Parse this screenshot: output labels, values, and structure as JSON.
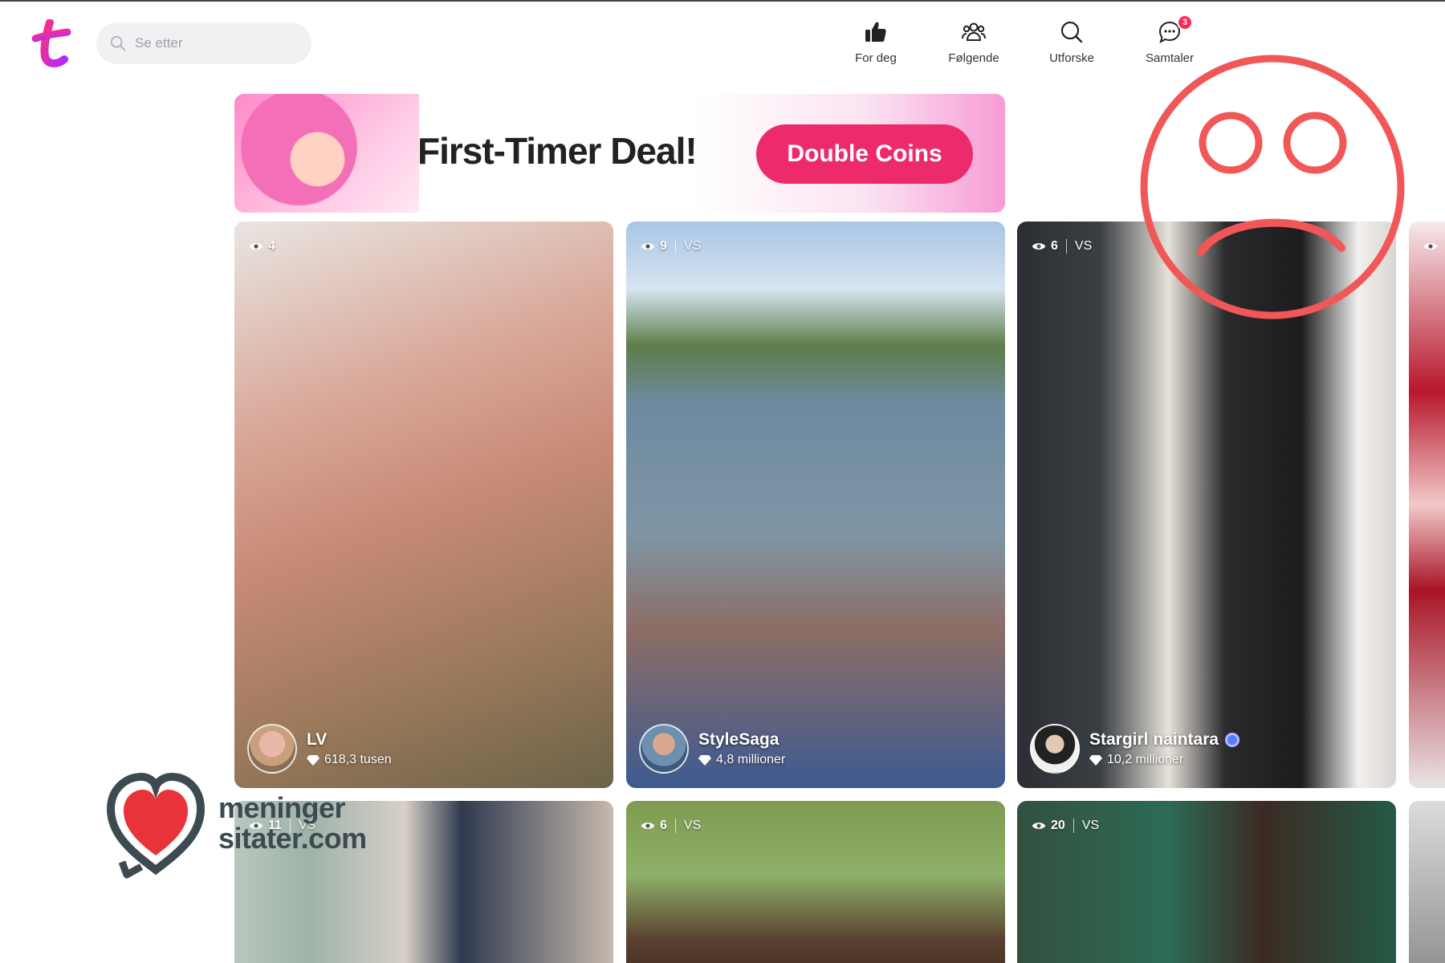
{
  "header": {
    "search_placeholder": "Se etter",
    "nav": [
      {
        "label": "For deg"
      },
      {
        "label": "Følgende"
      },
      {
        "label": "Utforske"
      },
      {
        "label": "Samtaler",
        "badge": "3"
      }
    ]
  },
  "banner": {
    "title": "First-Timer Deal!",
    "button_label": "Double Coins"
  },
  "cards": [
    {
      "views": "4",
      "vs": "",
      "name": "LV",
      "coins": "618,3 tusen",
      "verified": false
    },
    {
      "views": "9",
      "vs": "VS",
      "name": "StyleSaga",
      "coins": "4,8 millioner",
      "verified": false
    },
    {
      "views": "6",
      "vs": "VS",
      "name": "Stargirl naintara",
      "coins": "10,2 millioner",
      "verified": true
    }
  ],
  "cards_row2": [
    {
      "views": "11",
      "vs": "VS"
    },
    {
      "views": "6",
      "vs": "VS"
    },
    {
      "views": "20",
      "vs": "VS"
    }
  ],
  "watermark": {
    "line1": "meninger",
    "line2": "sitater.com"
  },
  "colors": {
    "accent": "#ee2b6a",
    "badge": "#fe2c55",
    "overlay": "#f15757"
  },
  "icons": [
    "search-icon",
    "thumbs-up-icon",
    "group-icon",
    "explore-icon",
    "chat-icon",
    "eye-icon",
    "diamond-icon",
    "verified-icon",
    "sad-face-icon",
    "heart-icon"
  ]
}
